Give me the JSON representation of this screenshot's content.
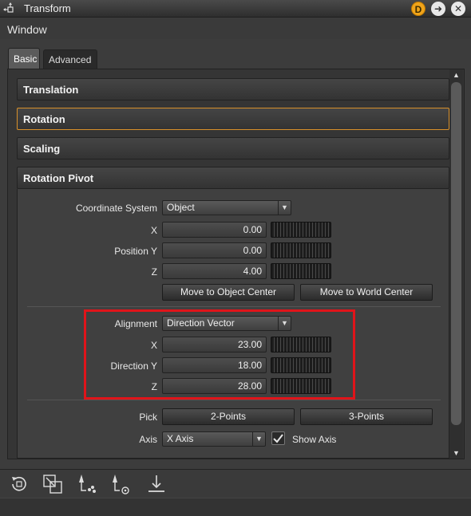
{
  "window": {
    "title": "Transform"
  },
  "titlebar_buttons": {
    "dock_label": "D",
    "dock_icon": "dock-badge-icon",
    "go_icon": "arrow-right-circle-icon",
    "close_icon": "close-circle-icon"
  },
  "menu": {
    "window_label": "Window"
  },
  "tabs": [
    {
      "label": "Basic",
      "selected": true
    },
    {
      "label": "Advanced",
      "selected": false
    }
  ],
  "sections": [
    {
      "label": "Translation",
      "expanded": false
    },
    {
      "label": "Rotation",
      "expanded": false,
      "focused": true
    },
    {
      "label": "Scaling",
      "expanded": false
    },
    {
      "label": "Rotation Pivot",
      "expanded": true
    }
  ],
  "pivot": {
    "coordinate_system": {
      "label": "Coordinate System",
      "value": "Object"
    },
    "position": {
      "x": {
        "label": "X",
        "value": "0.00"
      },
      "y": {
        "label": "Position Y",
        "value": "0.00"
      },
      "z": {
        "label": "Z",
        "value": "4.00"
      }
    },
    "move_to_object_center": "Move to Object Center",
    "move_to_world_center": "Move to World Center",
    "alignment": {
      "label": "Alignment",
      "value": "Direction Vector"
    },
    "direction": {
      "x": {
        "label": "X",
        "value": "23.00"
      },
      "y": {
        "label": "Direction Y",
        "value": "18.00"
      },
      "z": {
        "label": "Z",
        "value": "28.00"
      }
    },
    "pick": {
      "label": "Pick",
      "two_points": "2-Points",
      "three_points": "3-Points"
    },
    "axis": {
      "label": "Axis",
      "value": "X Axis",
      "show_axis_label": "Show Axis",
      "show_axis_checked": true
    }
  },
  "toolbar_icons": [
    "rotate-reset-icon",
    "move-to-center-icon",
    "pivot-to-selection-icon",
    "pivot-to-point-icon",
    "drop-to-ground-icon"
  ],
  "colors": {
    "accent": "#d8902a",
    "highlight_box": "#e0141a",
    "dock_badge": "#f0a41a"
  }
}
